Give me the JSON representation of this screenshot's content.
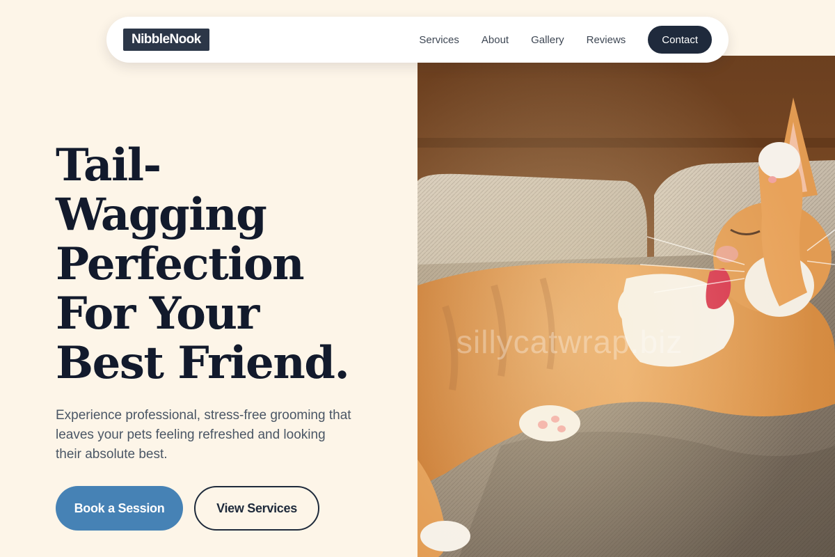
{
  "brand": {
    "logo_text": "NibbleNook"
  },
  "nav": {
    "links": [
      {
        "label": "Services"
      },
      {
        "label": "About"
      },
      {
        "label": "Gallery"
      },
      {
        "label": "Reviews"
      }
    ],
    "contact_label": "Contact"
  },
  "hero": {
    "title_lines": [
      "Tail-",
      "Wagging",
      "Perfection",
      "For Your",
      "Best Friend."
    ],
    "subtitle_lines": [
      "Experience professional, stress-free grooming that",
      "leaves your pets feeling refreshed and looking",
      "their absolute best."
    ],
    "primary_cta": "Book a Session",
    "secondary_cta": "View Services",
    "watermark_text": "sillycatwrap.biz"
  },
  "colors": {
    "page_background": "#fdf5e8",
    "logo_background": "#2c3748",
    "contact_button": "#1f2a3c",
    "primary_button": "#4682b5",
    "heading_text": "#121a2c"
  }
}
